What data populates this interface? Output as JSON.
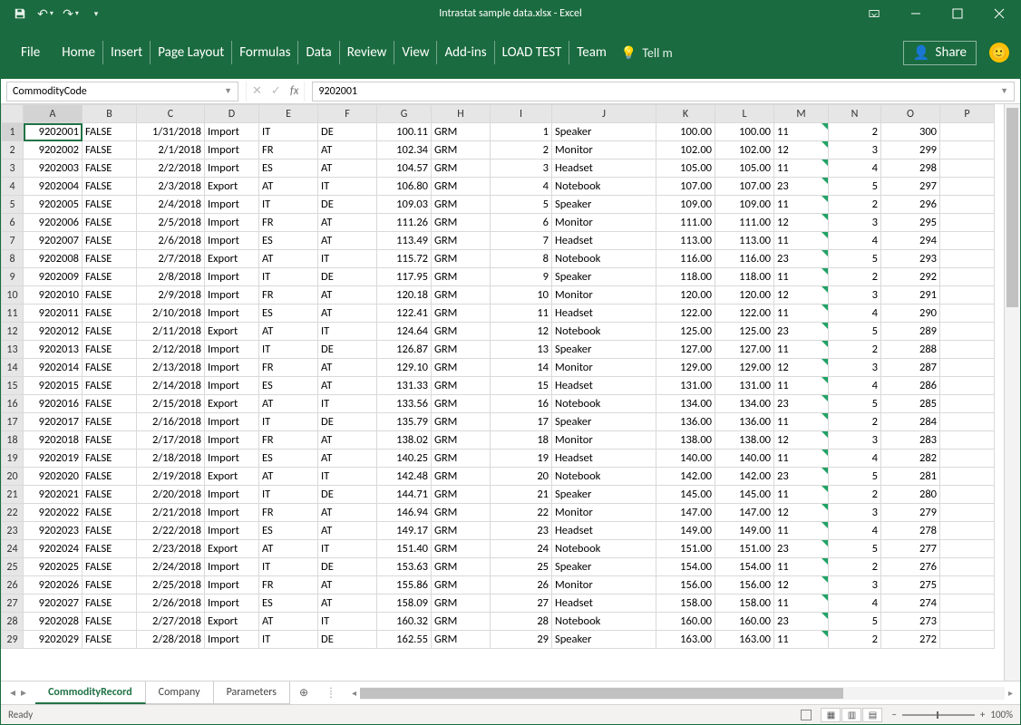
{
  "title": "Intrastat sample data.xlsx - Excel",
  "ribbon": {
    "file": "File",
    "tabs": [
      "Home",
      "Insert",
      "Page Layout",
      "Formulas",
      "Data",
      "Review",
      "View",
      "Add-ins",
      "LOAD TEST",
      "Team"
    ],
    "tellme": "Tell m",
    "share": "Share"
  },
  "namebox": "CommodityCode",
  "formula": "9202001",
  "columns": [
    "A",
    "B",
    "C",
    "D",
    "E",
    "F",
    "G",
    "H",
    "I",
    "J",
    "K",
    "L",
    "M",
    "N",
    "O",
    "P"
  ],
  "rows": [
    {
      "n": 1,
      "A": "9202001",
      "B": "FALSE",
      "C": "1/31/2018",
      "D": "Import",
      "E": "IT",
      "F": "DE",
      "G": "100.11",
      "H": "GRM",
      "I": "1",
      "J": "Speaker",
      "K": "100.00",
      "L": "100.00",
      "M": "11",
      "N": "2",
      "O": "300"
    },
    {
      "n": 2,
      "A": "9202002",
      "B": "FALSE",
      "C": "2/1/2018",
      "D": "Import",
      "E": "FR",
      "F": "AT",
      "G": "102.34",
      "H": "GRM",
      "I": "2",
      "J": "Monitor",
      "K": "102.00",
      "L": "102.00",
      "M": "12",
      "N": "3",
      "O": "299"
    },
    {
      "n": 3,
      "A": "9202003",
      "B": "FALSE",
      "C": "2/2/2018",
      "D": "Import",
      "E": "ES",
      "F": "AT",
      "G": "104.57",
      "H": "GRM",
      "I": "3",
      "J": "Headset",
      "K": "105.00",
      "L": "105.00",
      "M": "11",
      "N": "4",
      "O": "298"
    },
    {
      "n": 4,
      "A": "9202004",
      "B": "FALSE",
      "C": "2/3/2018",
      "D": "Export",
      "E": "AT",
      "F": "IT",
      "G": "106.80",
      "H": "GRM",
      "I": "4",
      "J": "Notebook",
      "K": "107.00",
      "L": "107.00",
      "M": "23",
      "N": "5",
      "O": "297"
    },
    {
      "n": 5,
      "A": "9202005",
      "B": "FALSE",
      "C": "2/4/2018",
      "D": "Import",
      "E": "IT",
      "F": "DE",
      "G": "109.03",
      "H": "GRM",
      "I": "5",
      "J": "Speaker",
      "K": "109.00",
      "L": "109.00",
      "M": "11",
      "N": "2",
      "O": "296"
    },
    {
      "n": 6,
      "A": "9202006",
      "B": "FALSE",
      "C": "2/5/2018",
      "D": "Import",
      "E": "FR",
      "F": "AT",
      "G": "111.26",
      "H": "GRM",
      "I": "6",
      "J": "Monitor",
      "K": "111.00",
      "L": "111.00",
      "M": "12",
      "N": "3",
      "O": "295"
    },
    {
      "n": 7,
      "A": "9202007",
      "B": "FALSE",
      "C": "2/6/2018",
      "D": "Import",
      "E": "ES",
      "F": "AT",
      "G": "113.49",
      "H": "GRM",
      "I": "7",
      "J": "Headset",
      "K": "113.00",
      "L": "113.00",
      "M": "11",
      "N": "4",
      "O": "294"
    },
    {
      "n": 8,
      "A": "9202008",
      "B": "FALSE",
      "C": "2/7/2018",
      "D": "Export",
      "E": "AT",
      "F": "IT",
      "G": "115.72",
      "H": "GRM",
      "I": "8",
      "J": "Notebook",
      "K": "116.00",
      "L": "116.00",
      "M": "23",
      "N": "5",
      "O": "293"
    },
    {
      "n": 9,
      "A": "9202009",
      "B": "FALSE",
      "C": "2/8/2018",
      "D": "Import",
      "E": "IT",
      "F": "DE",
      "G": "117.95",
      "H": "GRM",
      "I": "9",
      "J": "Speaker",
      "K": "118.00",
      "L": "118.00",
      "M": "11",
      "N": "2",
      "O": "292"
    },
    {
      "n": 10,
      "A": "9202010",
      "B": "FALSE",
      "C": "2/9/2018",
      "D": "Import",
      "E": "FR",
      "F": "AT",
      "G": "120.18",
      "H": "GRM",
      "I": "10",
      "J": "Monitor",
      "K": "120.00",
      "L": "120.00",
      "M": "12",
      "N": "3",
      "O": "291"
    },
    {
      "n": 11,
      "A": "9202011",
      "B": "FALSE",
      "C": "2/10/2018",
      "D": "Import",
      "E": "ES",
      "F": "AT",
      "G": "122.41",
      "H": "GRM",
      "I": "11",
      "J": "Headset",
      "K": "122.00",
      "L": "122.00",
      "M": "11",
      "N": "4",
      "O": "290"
    },
    {
      "n": 12,
      "A": "9202012",
      "B": "FALSE",
      "C": "2/11/2018",
      "D": "Export",
      "E": "AT",
      "F": "IT",
      "G": "124.64",
      "H": "GRM",
      "I": "12",
      "J": "Notebook",
      "K": "125.00",
      "L": "125.00",
      "M": "23",
      "N": "5",
      "O": "289"
    },
    {
      "n": 13,
      "A": "9202013",
      "B": "FALSE",
      "C": "2/12/2018",
      "D": "Import",
      "E": "IT",
      "F": "DE",
      "G": "126.87",
      "H": "GRM",
      "I": "13",
      "J": "Speaker",
      "K": "127.00",
      "L": "127.00",
      "M": "11",
      "N": "2",
      "O": "288"
    },
    {
      "n": 14,
      "A": "9202014",
      "B": "FALSE",
      "C": "2/13/2018",
      "D": "Import",
      "E": "FR",
      "F": "AT",
      "G": "129.10",
      "H": "GRM",
      "I": "14",
      "J": "Monitor",
      "K": "129.00",
      "L": "129.00",
      "M": "12",
      "N": "3",
      "O": "287"
    },
    {
      "n": 15,
      "A": "9202015",
      "B": "FALSE",
      "C": "2/14/2018",
      "D": "Import",
      "E": "ES",
      "F": "AT",
      "G": "131.33",
      "H": "GRM",
      "I": "15",
      "J": "Headset",
      "K": "131.00",
      "L": "131.00",
      "M": "11",
      "N": "4",
      "O": "286"
    },
    {
      "n": 16,
      "A": "9202016",
      "B": "FALSE",
      "C": "2/15/2018",
      "D": "Export",
      "E": "AT",
      "F": "IT",
      "G": "133.56",
      "H": "GRM",
      "I": "16",
      "J": "Notebook",
      "K": "134.00",
      "L": "134.00",
      "M": "23",
      "N": "5",
      "O": "285"
    },
    {
      "n": 17,
      "A": "9202017",
      "B": "FALSE",
      "C": "2/16/2018",
      "D": "Import",
      "E": "IT",
      "F": "DE",
      "G": "135.79",
      "H": "GRM",
      "I": "17",
      "J": "Speaker",
      "K": "136.00",
      "L": "136.00",
      "M": "11",
      "N": "2",
      "O": "284"
    },
    {
      "n": 18,
      "A": "9202018",
      "B": "FALSE",
      "C": "2/17/2018",
      "D": "Import",
      "E": "FR",
      "F": "AT",
      "G": "138.02",
      "H": "GRM",
      "I": "18",
      "J": "Monitor",
      "K": "138.00",
      "L": "138.00",
      "M": "12",
      "N": "3",
      "O": "283"
    },
    {
      "n": 19,
      "A": "9202019",
      "B": "FALSE",
      "C": "2/18/2018",
      "D": "Import",
      "E": "ES",
      "F": "AT",
      "G": "140.25",
      "H": "GRM",
      "I": "19",
      "J": "Headset",
      "K": "140.00",
      "L": "140.00",
      "M": "11",
      "N": "4",
      "O": "282"
    },
    {
      "n": 20,
      "A": "9202020",
      "B": "FALSE",
      "C": "2/19/2018",
      "D": "Export",
      "E": "AT",
      "F": "IT",
      "G": "142.48",
      "H": "GRM",
      "I": "20",
      "J": "Notebook",
      "K": "142.00",
      "L": "142.00",
      "M": "23",
      "N": "5",
      "O": "281"
    },
    {
      "n": 21,
      "A": "9202021",
      "B": "FALSE",
      "C": "2/20/2018",
      "D": "Import",
      "E": "IT",
      "F": "DE",
      "G": "144.71",
      "H": "GRM",
      "I": "21",
      "J": "Speaker",
      "K": "145.00",
      "L": "145.00",
      "M": "11",
      "N": "2",
      "O": "280"
    },
    {
      "n": 22,
      "A": "9202022",
      "B": "FALSE",
      "C": "2/21/2018",
      "D": "Import",
      "E": "FR",
      "F": "AT",
      "G": "146.94",
      "H": "GRM",
      "I": "22",
      "J": "Monitor",
      "K": "147.00",
      "L": "147.00",
      "M": "12",
      "N": "3",
      "O": "279"
    },
    {
      "n": 23,
      "A": "9202023",
      "B": "FALSE",
      "C": "2/22/2018",
      "D": "Import",
      "E": "ES",
      "F": "AT",
      "G": "149.17",
      "H": "GRM",
      "I": "23",
      "J": "Headset",
      "K": "149.00",
      "L": "149.00",
      "M": "11",
      "N": "4",
      "O": "278"
    },
    {
      "n": 24,
      "A": "9202024",
      "B": "FALSE",
      "C": "2/23/2018",
      "D": "Export",
      "E": "AT",
      "F": "IT",
      "G": "151.40",
      "H": "GRM",
      "I": "24",
      "J": "Notebook",
      "K": "151.00",
      "L": "151.00",
      "M": "23",
      "N": "5",
      "O": "277"
    },
    {
      "n": 25,
      "A": "9202025",
      "B": "FALSE",
      "C": "2/24/2018",
      "D": "Import",
      "E": "IT",
      "F": "DE",
      "G": "153.63",
      "H": "GRM",
      "I": "25",
      "J": "Speaker",
      "K": "154.00",
      "L": "154.00",
      "M": "11",
      "N": "2",
      "O": "276"
    },
    {
      "n": 26,
      "A": "9202026",
      "B": "FALSE",
      "C": "2/25/2018",
      "D": "Import",
      "E": "FR",
      "F": "AT",
      "G": "155.86",
      "H": "GRM",
      "I": "26",
      "J": "Monitor",
      "K": "156.00",
      "L": "156.00",
      "M": "12",
      "N": "3",
      "O": "275"
    },
    {
      "n": 27,
      "A": "9202027",
      "B": "FALSE",
      "C": "2/26/2018",
      "D": "Import",
      "E": "ES",
      "F": "AT",
      "G": "158.09",
      "H": "GRM",
      "I": "27",
      "J": "Headset",
      "K": "158.00",
      "L": "158.00",
      "M": "11",
      "N": "4",
      "O": "274"
    },
    {
      "n": 28,
      "A": "9202028",
      "B": "FALSE",
      "C": "2/27/2018",
      "D": "Export",
      "E": "AT",
      "F": "IT",
      "G": "160.32",
      "H": "GRM",
      "I": "28",
      "J": "Notebook",
      "K": "160.00",
      "L": "160.00",
      "M": "23",
      "N": "5",
      "O": "273"
    },
    {
      "n": 29,
      "A": "9202029",
      "B": "FALSE",
      "C": "2/28/2018",
      "D": "Import",
      "E": "IT",
      "F": "DE",
      "G": "162.55",
      "H": "GRM",
      "I": "29",
      "J": "Speaker",
      "K": "163.00",
      "L": "163.00",
      "M": "11",
      "N": "2",
      "O": "272"
    }
  ],
  "sheets": [
    "CommodityRecord",
    "Company",
    "Parameters"
  ],
  "activeSheet": 0,
  "status": "Ready",
  "zoom": "100%"
}
